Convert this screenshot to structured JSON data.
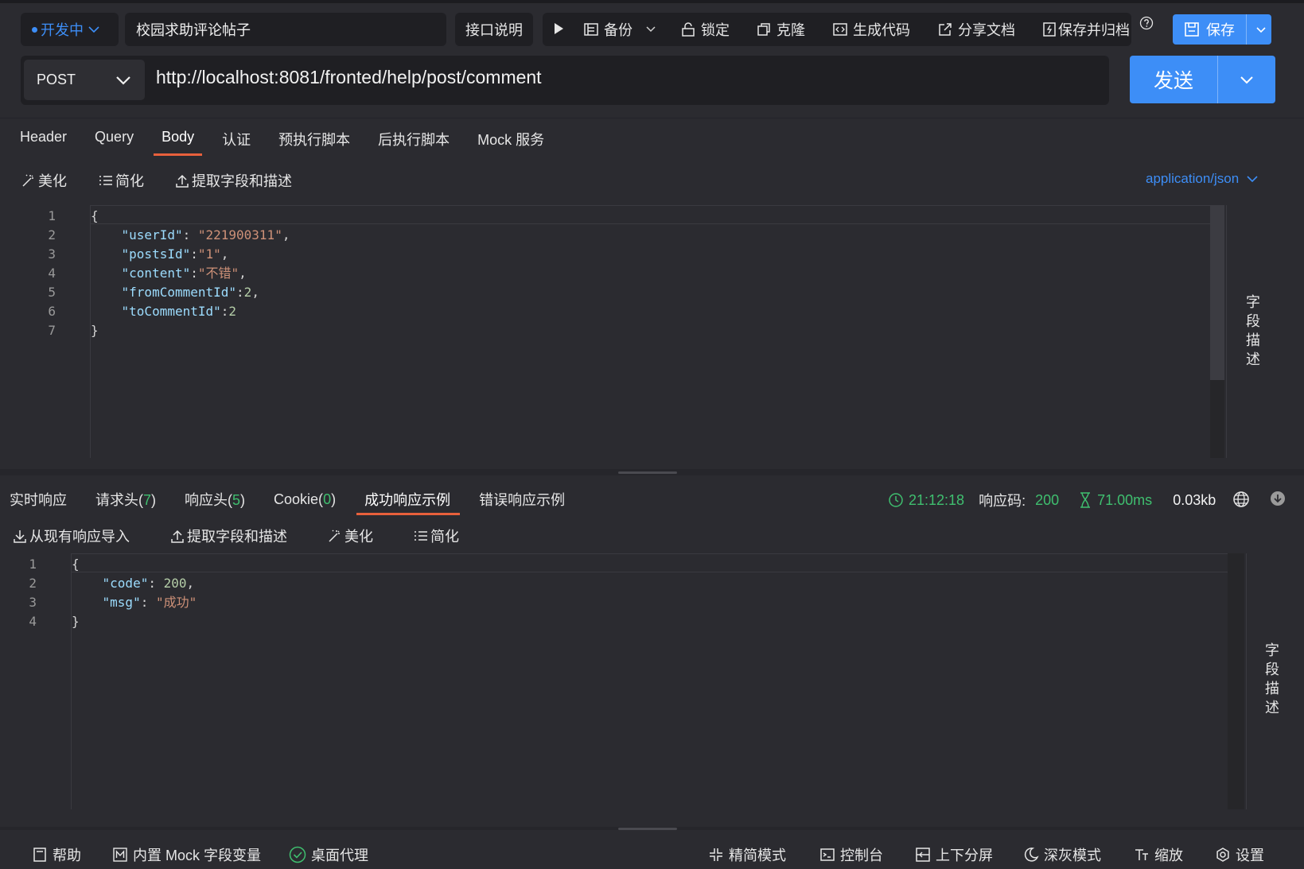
{
  "header": {
    "status_label": "开发中",
    "api_name": "校园求助评论帖子",
    "doc_label": "接口说明",
    "backup_label": "备份",
    "lock_label": "锁定",
    "clone_label": "克隆",
    "gencode_label": "生成代码",
    "share_label": "分享文档",
    "save_archive_label": "保存并归档",
    "save_label": "保存"
  },
  "request": {
    "method": "POST",
    "url": "http://localhost:8081/fronted/help/post/comment",
    "send_label": "发送"
  },
  "req_tabs": [
    "Header",
    "Query",
    "Body",
    "认证",
    "预执行脚本",
    "后执行脚本",
    "Mock 服务"
  ],
  "req_tools": {
    "beautify": "美化",
    "simplify": "简化",
    "extract": "提取字段和描述",
    "content_type": "application/json"
  },
  "body_lines": [
    {
      "n": "1",
      "parts": [
        [
          "p",
          "{"
        ]
      ]
    },
    {
      "n": "2",
      "parts": [
        [
          "p",
          "    "
        ],
        [
          "k",
          "\"userId\""
        ],
        [
          "p",
          ": "
        ],
        [
          "s",
          "\"221900311\""
        ],
        [
          "p",
          ","
        ]
      ]
    },
    {
      "n": "3",
      "parts": [
        [
          "p",
          "    "
        ],
        [
          "k",
          "\"postsId\""
        ],
        [
          "p",
          ":"
        ],
        [
          "s",
          "\"1\""
        ],
        [
          "p",
          ","
        ]
      ]
    },
    {
      "n": "4",
      "parts": [
        [
          "p",
          "    "
        ],
        [
          "k",
          "\"content\""
        ],
        [
          "p",
          ":"
        ],
        [
          "s",
          "\"不错\""
        ],
        [
          "p",
          ","
        ]
      ]
    },
    {
      "n": "5",
      "parts": [
        [
          "p",
          "    "
        ],
        [
          "k",
          "\"fromCommentId\""
        ],
        [
          "p",
          ":"
        ],
        [
          "n",
          "2"
        ],
        [
          "p",
          ","
        ]
      ]
    },
    {
      "n": "6",
      "parts": [
        [
          "p",
          "    "
        ],
        [
          "k",
          "\"toCommentId\""
        ],
        [
          "p",
          ":"
        ],
        [
          "n",
          "2"
        ]
      ]
    },
    {
      "n": "7",
      "parts": [
        [
          "p",
          "}"
        ]
      ]
    }
  ],
  "field_desc_label": [
    "字",
    "段",
    "描",
    "述"
  ],
  "resp_tabs": {
    "realtime": "实时响应",
    "req_headers": "请求头(",
    "req_headers_count": "7",
    "resp_headers": "响应头(",
    "resp_headers_count": "5",
    "cookie": "Cookie(",
    "cookie_count": "0",
    "close_paren": ")",
    "success_example": "成功响应示例",
    "error_example": "错误响应示例"
  },
  "resp_status": {
    "time": "21:12:18",
    "code_label": "响应码:",
    "code": "200",
    "duration": "71.00ms",
    "size": "0.03kb"
  },
  "resp_tools": {
    "import": "从现有响应导入",
    "extract": "提取字段和描述",
    "beautify": "美化",
    "simplify": "简化"
  },
  "resp_lines": [
    {
      "n": "1",
      "parts": [
        [
          "p",
          "{"
        ]
      ]
    },
    {
      "n": "2",
      "parts": [
        [
          "p",
          "    "
        ],
        [
          "k",
          "\"code\""
        ],
        [
          "p",
          ": "
        ],
        [
          "n",
          "200"
        ],
        [
          "p",
          ","
        ]
      ]
    },
    {
      "n": "3",
      "parts": [
        [
          "p",
          "    "
        ],
        [
          "k",
          "\"msg\""
        ],
        [
          "p",
          ": "
        ],
        [
          "s",
          "\"成功\""
        ]
      ]
    },
    {
      "n": "4",
      "parts": [
        [
          "p",
          "}"
        ]
      ]
    }
  ],
  "footer": {
    "help": "帮助",
    "mock_vars": "内置 Mock 字段变量",
    "desktop_proxy": "桌面代理",
    "compact": "精简模式",
    "console": "控制台",
    "split": "上下分屏",
    "dark_gray": "深灰模式",
    "zoom": "缩放",
    "settings": "设置"
  },
  "colors": {
    "accent": "#3d8ef7",
    "success": "#3fbf6f",
    "tab_underline": "#e8603c"
  }
}
